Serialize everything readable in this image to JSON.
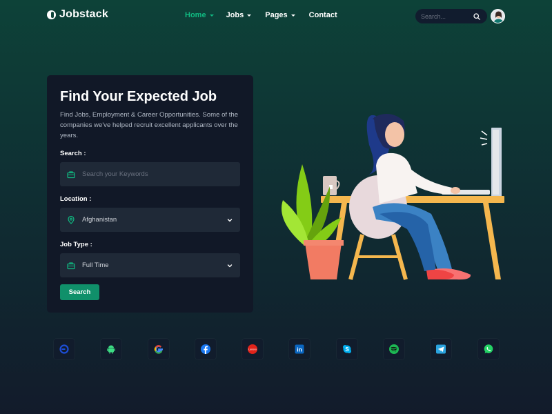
{
  "brand": {
    "name": "Jobstack"
  },
  "nav": {
    "items": [
      {
        "label": "Home",
        "active": true,
        "dropdown": true
      },
      {
        "label": "Jobs",
        "active": false,
        "dropdown": true
      },
      {
        "label": "Pages",
        "active": false,
        "dropdown": true
      },
      {
        "label": "Contact",
        "active": false,
        "dropdown": false
      }
    ],
    "search_placeholder": "Search..."
  },
  "hero": {
    "title": "Find Your Expected Job",
    "description": "Find Jobs, Employment & Career Opportunities. Some of the companies we've helped recruit excellent applicants over the years.",
    "search_label": "Search :",
    "search_placeholder": "Search your Keywords",
    "location_label": "Location :",
    "location_value": "Afghanistan",
    "jobtype_label": "Job Type :",
    "jobtype_value": "Full Time",
    "button_label": "Search"
  },
  "companies": [
    {
      "name": "circle-logo-icon",
      "color": "#1d4ed8"
    },
    {
      "name": "android-icon",
      "color": "#3ddc84"
    },
    {
      "name": "google-icon",
      "color": "#4285f4"
    },
    {
      "name": "facebook-icon",
      "color": "#1877f2"
    },
    {
      "name": "lenovo-icon",
      "color": "#e2231a",
      "text": "Lenovo"
    },
    {
      "name": "linkedin-icon",
      "color": "#0a66c2",
      "text": "in"
    },
    {
      "name": "skype-icon",
      "color": "#00aff0",
      "text": "S"
    },
    {
      "name": "spotify-icon",
      "color": "#1db954"
    },
    {
      "name": "telegram-icon",
      "color": "#2aa3df"
    },
    {
      "name": "whatsapp-icon",
      "color": "#25d366"
    }
  ],
  "colors": {
    "accent": "#10b981",
    "button": "#10906a",
    "card": "#111827",
    "field": "#1f2937"
  }
}
